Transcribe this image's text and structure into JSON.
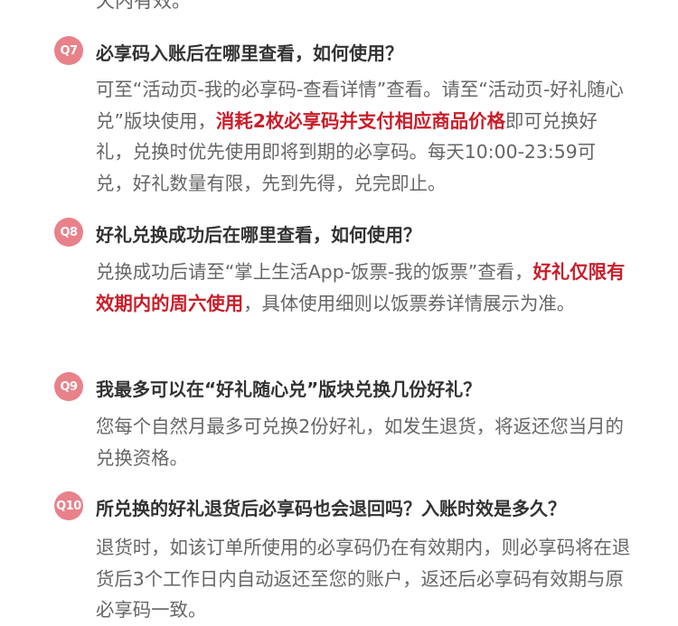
{
  "partial_top_text": "天内有效。",
  "items": [
    {
      "badge": "Q7",
      "question": "必享码入账后在哪里查看，如何使用？",
      "answer": [
        {
          "t": "可至“活动页-我的必享码-查看详情”查看。请至“活动页-好礼随心兑”版块使用，"
        },
        {
          "t": "消耗2枚必享码并支付相应商品价格",
          "hl": true
        },
        {
          "t": "即可兑换好礼，兑换时优先使用即将到期的必享码。每天10:00-23:59可兑，好礼数量有限，先到先得，兑完即止。"
        }
      ]
    },
    {
      "badge": "Q8",
      "question": "好礼兑换成功后在哪里查看，如何使用？",
      "answer": [
        {
          "t": "兑换成功后请至“掌上生活App-饭票-我的饭票”查看，"
        },
        {
          "t": "好礼仅限有效期内的周六使用",
          "hl": true
        },
        {
          "t": "，具体使用细则以饭票券详情展示为准。"
        }
      ]
    },
    {
      "badge": "Q9",
      "question": "我最多可以在“好礼随心兑”版块兑换几份好礼？",
      "answer": [
        {
          "t": "您每个自然月最多可兑换2份好礼，如发生退货，将返还您当月的兑换资格。"
        }
      ]
    },
    {
      "badge": "Q10",
      "question": "所兑换的好礼退货后必享码也会退回吗？入账时效是多久？",
      "answer": [
        {
          "t": "退货时，如该订单所使用的必享码仍在有效期内，则必享码将在退货后3个工作日内自动返还至您的账户，返还后必享码有效期与原必享码一致。"
        }
      ]
    }
  ]
}
